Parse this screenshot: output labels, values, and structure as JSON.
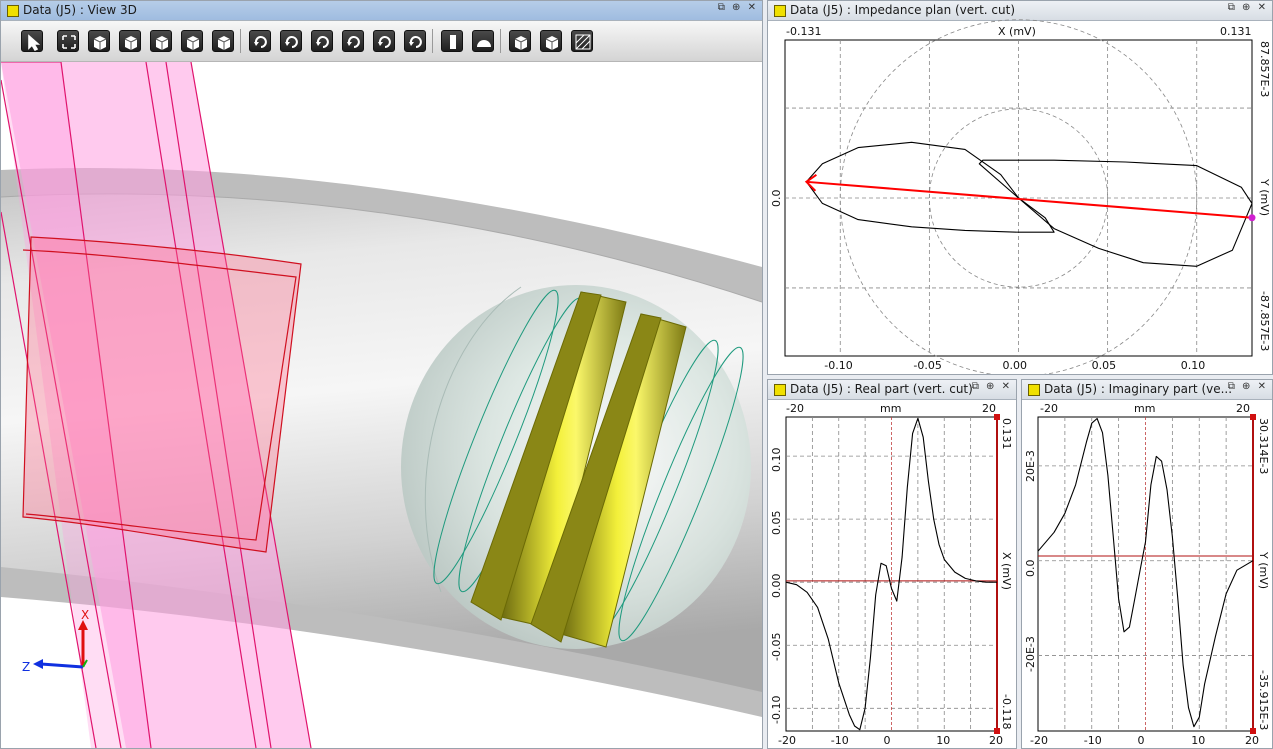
{
  "view3d": {
    "title": "Data (J5) : View 3D",
    "win_btns": "⧉ ⊕ ✕",
    "axis_x": "X",
    "axis_z": "Z",
    "toolbar": [
      {
        "name": "select-tool-icon"
      },
      {
        "name": "fit-view-icon"
      },
      {
        "name": "view-front-icon"
      },
      {
        "name": "view-side-icon"
      },
      {
        "name": "view-top-icon"
      },
      {
        "name": "view-iso-icon"
      },
      {
        "name": "view-box-icon"
      },
      {
        "name": "rotate-left-icon"
      },
      {
        "name": "rotate-right-icon"
      },
      {
        "name": "rotate-up-icon"
      },
      {
        "name": "rotate-down-icon"
      },
      {
        "name": "rotate-ccw-icon"
      },
      {
        "name": "rotate-cw-icon"
      },
      {
        "name": "ruler-icon"
      },
      {
        "name": "protractor-icon"
      },
      {
        "name": "wireframe-icon"
      },
      {
        "name": "solid-icon"
      },
      {
        "name": "hatch-icon"
      }
    ]
  },
  "impedance": {
    "title": "Data (J5) : Impedance plan (vert. cut)",
    "win_btns": "⧉ ⊕ ✕",
    "x_min": "-0.131",
    "x_max": "0.131",
    "x_label": "X (mV)",
    "y_max": "87.857E-3",
    "y_min": "-87.857E-3",
    "y_label": "Y (mV)",
    "y_zero": "0.0",
    "x_ticks": [
      "-0.10",
      "-0.05",
      "0.00",
      "0.05",
      "0.10"
    ]
  },
  "real": {
    "title": "Data (J5) : Real part (vert. cut)",
    "win_btns": "⧉ ⊕ ✕",
    "top_left": "-20",
    "top_right": "20",
    "top_label": "mm",
    "y_max": "0.131",
    "y_min": "-0.118",
    "y_label": "X (mV)",
    "y_ticks": [
      "0.10",
      "0.05",
      "0.00",
      "-0.05",
      "-0.10"
    ],
    "x_ticks": [
      "-20",
      "-10",
      "0",
      "10",
      "20"
    ]
  },
  "imag": {
    "title": "Data (J5) : Imaginary part (ve...",
    "win_btns": "⧉ ⊕ ✕",
    "top_left": "-20",
    "top_right": "20",
    "top_label": "mm",
    "y_max": "30.314E-3",
    "y_min": "-35.915E-3",
    "y_label": "Y (mV)",
    "y_ticks": [
      "20E-3",
      "0.0",
      "-20E-3"
    ],
    "x_ticks": [
      "-20",
      "-10",
      "0",
      "10",
      "20"
    ]
  },
  "chart_data": [
    {
      "type": "line",
      "title": "Impedance plan (vert. cut)",
      "xlabel": "X (mV)",
      "ylabel": "Y (mV)",
      "xlim": [
        -0.131,
        0.131
      ],
      "ylim": [
        -0.087857,
        0.087857
      ],
      "series": [
        {
          "x": [
            -0.119,
            -0.11,
            -0.09,
            -0.06,
            -0.03,
            -0.01,
            0.0,
            0.015,
            0.02,
            -0.0,
            -0.03,
            -0.06,
            -0.09,
            -0.11,
            -0.119
          ],
          "y": [
            0.009,
            0.019,
            0.028,
            0.031,
            0.027,
            0.013,
            0.0,
            -0.011,
            -0.019,
            -0.019,
            -0.018,
            -0.016,
            -0.012,
            -0.003,
            0.009
          ]
        },
        {
          "x": [
            0.0,
            -0.022,
            -0.02,
            0.02,
            0.06,
            0.1,
            0.125,
            0.131,
            0.12,
            0.1,
            0.07,
            0.045,
            0.02,
            0.0
          ],
          "y": [
            0.0,
            0.019,
            0.021,
            0.021,
            0.02,
            0.018,
            0.006,
            -0.003,
            -0.029,
            -0.038,
            -0.036,
            -0.028,
            -0.017,
            0.0
          ]
        }
      ],
      "vector": {
        "from": [
          0.131,
          -0.011
        ],
        "to": [
          -0.119,
          0.009
        ],
        "color": "#ff0000"
      },
      "grid": true
    },
    {
      "type": "line",
      "title": "Real part (vert. cut)",
      "xlabel": "mm",
      "ylabel": "X (mV)",
      "xlim": [
        -20,
        20
      ],
      "ylim": [
        -0.118,
        0.131
      ],
      "x": [
        -20,
        -18,
        -16,
        -14,
        -12,
        -10,
        -8,
        -7,
        -6,
        -5,
        -4,
        -3,
        -2,
        -1,
        0,
        1,
        2,
        3,
        4,
        5,
        6,
        7,
        8,
        9,
        10,
        12,
        14,
        16,
        18,
        20
      ],
      "series": [
        {
          "values": [
            0.0,
            -0.002,
            -0.008,
            -0.02,
            -0.045,
            -0.08,
            -0.105,
            -0.114,
            -0.117,
            -0.1,
            -0.06,
            -0.01,
            0.015,
            0.013,
            -0.005,
            -0.015,
            0.02,
            0.075,
            0.118,
            0.13,
            0.115,
            0.08,
            0.05,
            0.03,
            0.018,
            0.008,
            0.003,
            0.001,
            0.0,
            0.0
          ]
        }
      ],
      "cursor_x": 0,
      "grid": true
    },
    {
      "type": "line",
      "title": "Imaginary part (vert. cut)",
      "xlabel": "mm",
      "ylabel": "Y (mV)",
      "xlim": [
        -20,
        20
      ],
      "ylim": [
        -0.035915,
        0.030314
      ],
      "x": [
        -20,
        -17,
        -15,
        -13,
        -11,
        -10,
        -9,
        -8,
        -7,
        -6,
        -5,
        -4,
        -3,
        -2,
        -1,
        0,
        1,
        2,
        3,
        4,
        5,
        6,
        7,
        8,
        9,
        10,
        11,
        13,
        15,
        17,
        20
      ],
      "series": [
        {
          "values": [
            0.002,
            0.006,
            0.01,
            0.016,
            0.025,
            0.029,
            0.03,
            0.027,
            0.018,
            0.005,
            -0.008,
            -0.015,
            -0.014,
            -0.008,
            -0.002,
            0.004,
            0.016,
            0.022,
            0.021,
            0.015,
            0.005,
            -0.008,
            -0.022,
            -0.031,
            -0.035,
            -0.033,
            -0.026,
            -0.016,
            -0.007,
            -0.002,
            0.0
          ]
        }
      ],
      "cursor_x": 0,
      "grid": true
    }
  ]
}
